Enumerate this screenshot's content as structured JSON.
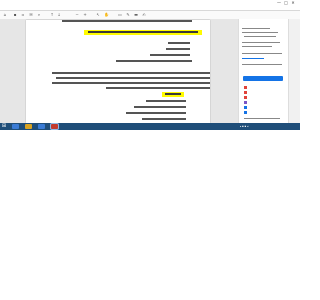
{
  "window": {
    "title": "",
    "controls": [
      "—",
      "□",
      "✕"
    ]
  },
  "menu": {
    "items": [
      "",
      "",
      "",
      "",
      "",
      ""
    ]
  },
  "toolbar": {
    "icons": [
      "home-icon",
      "save-icon",
      "print-icon",
      "mail-icon",
      "search-icon",
      "page-up-icon",
      "page-down-icon",
      "zoom-out-icon",
      "zoom-in-icon",
      "select-icon",
      "hand-icon",
      "comment-icon",
      "pen-icon",
      "highlight-icon",
      "sign-icon"
    ]
  },
  "right_panel": {
    "search_placeholder": "",
    "export_heading": "",
    "export_subtitle": "",
    "format_label": "",
    "primary_button": "",
    "tools": [
      "",
      "",
      "",
      "",
      "",
      ""
    ],
    "footer_text": ""
  },
  "taskbar": {
    "clock_time": "",
    "clock_date": ""
  }
}
